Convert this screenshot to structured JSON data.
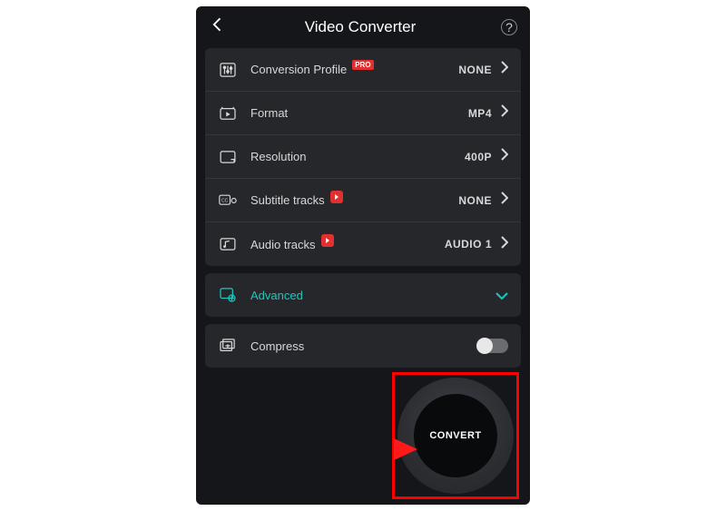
{
  "header": {
    "title": "Video Converter"
  },
  "settings": [
    {
      "icon": "sliders",
      "label": "Conversion Profile",
      "badge": "PRO",
      "value": "NONE"
    },
    {
      "icon": "format",
      "label": "Format",
      "value": "MP4"
    },
    {
      "icon": "resolution",
      "label": "Resolution",
      "value": "400P"
    },
    {
      "icon": "cc",
      "label": "Subtitle tracks",
      "red_dot": true,
      "value": "NONE"
    },
    {
      "icon": "audio",
      "label": "Audio tracks",
      "red_dot": true,
      "value": "AUDIO 1"
    }
  ],
  "advanced": {
    "label": "Advanced"
  },
  "compress": {
    "label": "Compress",
    "on": false
  },
  "fab": {
    "label": "CONVERT"
  }
}
